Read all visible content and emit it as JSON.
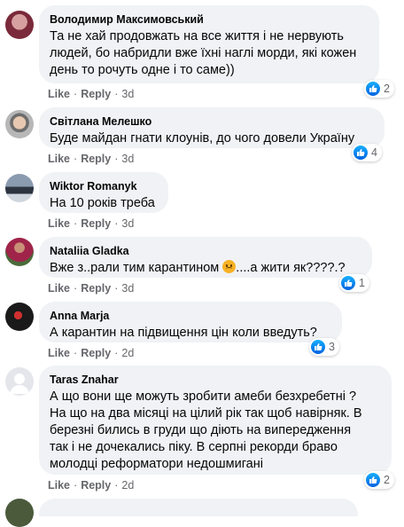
{
  "actions": {
    "like": "Like",
    "reply": "Reply",
    "sep": "·"
  },
  "comments": [
    {
      "author": "Володимир Максимовський",
      "text": "Та не хай продовжать на все життя і не нервують\nлюдей, бо набридли вже їхні наглі морди, які кожен\nдень то рочуть одне і то саме))",
      "time": "3d",
      "reactions": "2"
    },
    {
      "author": "Світлана Мелешко",
      "text": "Буде майдан гнати клоунів, до чого довели Україну",
      "time": "3d",
      "reactions": "4"
    },
    {
      "author": "Wiktor Romanyk",
      "text": "На 10 років треба",
      "time": "3d",
      "reactions": ""
    },
    {
      "author": "Nataliia Gladka",
      "text_before": "Вже з..рали тим карантином ",
      "text_after": "....а жити як????.?",
      "time": "3d",
      "reactions": "1"
    },
    {
      "author": "Anna Marja",
      "text": "А карантин на підвищення цін коли введуть?",
      "time": "2d",
      "reactions": "3"
    },
    {
      "author": "Taras Znahar",
      "text": "А що вони ще можуть зробити амеби безхребетні ?\nНа що на два місяці на цілий рік так щоб навірняк. В\nберезні бились в груди що діють на випередження\nтак і не дочекались піку. В серпні рекорди браво\nмолодці реформатори недошмигані",
      "time": "2d",
      "reactions": "2"
    }
  ]
}
